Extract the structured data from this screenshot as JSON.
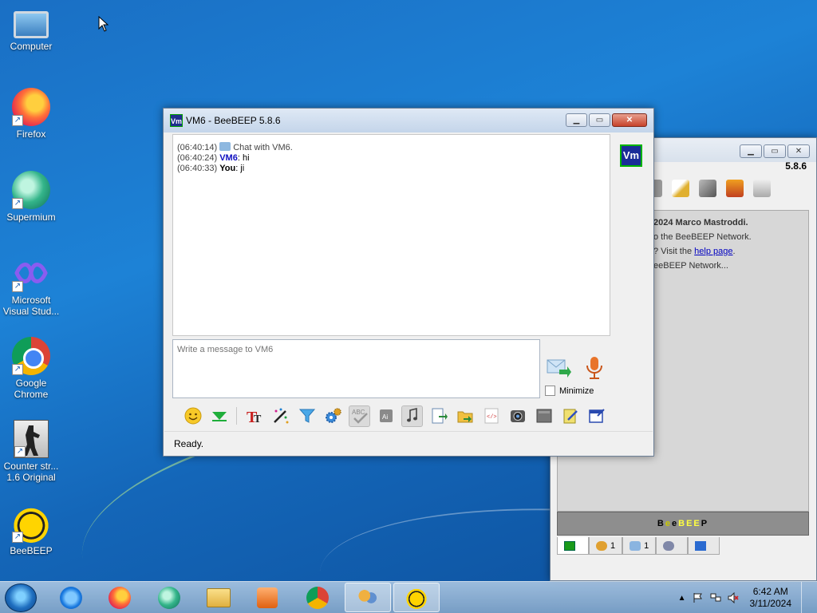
{
  "desktop": {
    "icons": [
      {
        "label": "Computer"
      },
      {
        "label": "Firefox"
      },
      {
        "label": "Supermium"
      },
      {
        "label": "Microsoft Visual Stud..."
      },
      {
        "label": "Google Chrome"
      },
      {
        "label": "Counter str... 1.6 Original"
      },
      {
        "label": "BeeBEEP"
      }
    ]
  },
  "back_window": {
    "version": "5.8.6",
    "content": {
      "line1": "2024 Marco Mastroddi.",
      "line2": "o the BeeBEEP Network.",
      "line3_prefix": "? Visit the ",
      "line3_link": "help page",
      "line3_suffix": ".",
      "line4": "eeBEEP Network..."
    },
    "banner": [
      "B",
      "e",
      "e",
      "B",
      "E",
      "E",
      "P"
    ],
    "banner_colors": [
      "#000000",
      "#c8c800",
      "#000000",
      "#ffff40",
      "#ffff40",
      "#ffff40",
      "#000000"
    ],
    "tabs": [
      {
        "icon": "chat-icon",
        "count": ""
      },
      {
        "icon": "users-icon",
        "count": "1"
      },
      {
        "icon": "chats-icon",
        "count": "1"
      },
      {
        "icon": "groups-icon",
        "count": ""
      },
      {
        "icon": "network-icon",
        "count": ""
      }
    ]
  },
  "chat_window": {
    "title": "VM6 - BeeBEEP 5.8.6",
    "title_icon_text": "Vm",
    "avatar_text": "Vm",
    "messages": {
      "m1": {
        "time": "(06:40:14)",
        "text": "Chat with VM6."
      },
      "m2": {
        "time": "(06:40:24)",
        "who": "VM6",
        "text": ": hi"
      },
      "m3": {
        "time": "(06:40:33)",
        "who": "You",
        "text": ": ji"
      }
    },
    "input_placeholder": "Write a message to VM6",
    "minimize_label": "Minimize",
    "status": "Ready."
  },
  "taskbar": {
    "time": "6:42 AM",
    "date": "3/11/2024"
  },
  "colors": {
    "accent": "#1f2f8c",
    "vm6_name": "#1010c0"
  }
}
